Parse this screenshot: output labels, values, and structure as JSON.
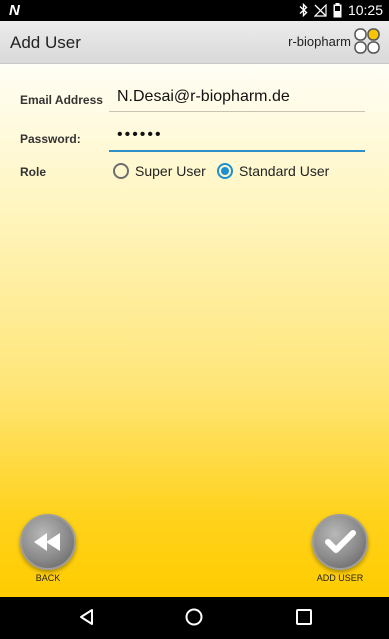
{
  "status_bar": {
    "time": "10:25",
    "left_icon": "N",
    "icons": [
      "bluetooth-icon",
      "no-signal-icon",
      "battery-icon"
    ]
  },
  "app_bar": {
    "title": "Add User",
    "logo_text": "r-biopharm"
  },
  "form": {
    "email": {
      "label": "Email Address",
      "value": "N.Desai@r-biopharm.de"
    },
    "password": {
      "label": "Password:",
      "value": "••••••"
    },
    "role": {
      "label": "Role",
      "options": [
        {
          "label": "Super User",
          "selected": false
        },
        {
          "label": "Standard User",
          "selected": true
        }
      ]
    }
  },
  "buttons": {
    "back": {
      "label": "BACK",
      "icon": "rewind-icon"
    },
    "add_user": {
      "label": "ADD USER",
      "icon": "checkmark-icon"
    }
  },
  "nav": [
    "back-triangle-icon",
    "home-circle-icon",
    "recents-square-icon"
  ],
  "colors": {
    "accent": "#1b8fcf",
    "background_top": "#fffef6",
    "background_bottom": "#ffcc00"
  }
}
